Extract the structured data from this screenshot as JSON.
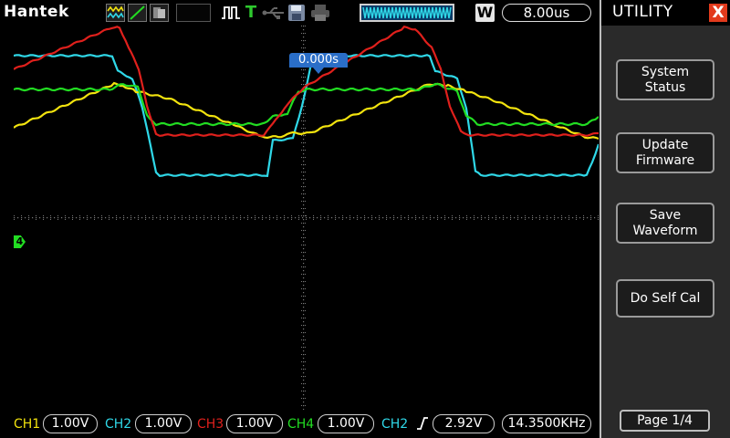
{
  "brand": "Hantek",
  "timeline_colors": {
    "frame": "#cfcfcf",
    "fill": "#0a3a66",
    "wave": "#2fd8e8"
  },
  "top": {
    "trigger_indicator": "T",
    "mode_badge": "W",
    "timebase": "8.00us"
  },
  "icons": {
    "wave": "waveform-icon",
    "line": "line-draw-icon",
    "persist": "persistence-icon",
    "pulse": "pulse-icon",
    "trigger": "trigger-icon",
    "usb": "usb-icon",
    "save": "save-icon",
    "print": "printer-icon",
    "edge": "rising-edge-icon"
  },
  "trigger_time": "0.000s",
  "ch4_marker": "4",
  "panel": {
    "title": "UTILITY",
    "close": "X",
    "buttons": [
      {
        "label": "System\nStatus"
      },
      {
        "label": "Update\nFirmware"
      },
      {
        "label": "Save\nWaveform"
      },
      {
        "label": "Do Self Cal"
      }
    ],
    "page": "Page 1/4"
  },
  "channels": [
    {
      "name": "CH1",
      "scale": "1.00V",
      "color": "#f2e30e"
    },
    {
      "name": "CH2",
      "scale": "1.00V",
      "color": "#2fd8e8"
    },
    {
      "name": "CH3",
      "scale": "1.00V",
      "color": "#e0201c"
    },
    {
      "name": "CH4",
      "scale": "1.00V",
      "color": "#22dd22"
    }
  ],
  "trigger": {
    "source": "CH2",
    "level": "2.92V",
    "frequency": "14.3500KHz"
  },
  "colors": {
    "grid": "#7a7a7a",
    "panel_bg": "#2a2a2a",
    "close": "#e23a1c",
    "trigger_time_bg": "#2a6ec8"
  }
}
